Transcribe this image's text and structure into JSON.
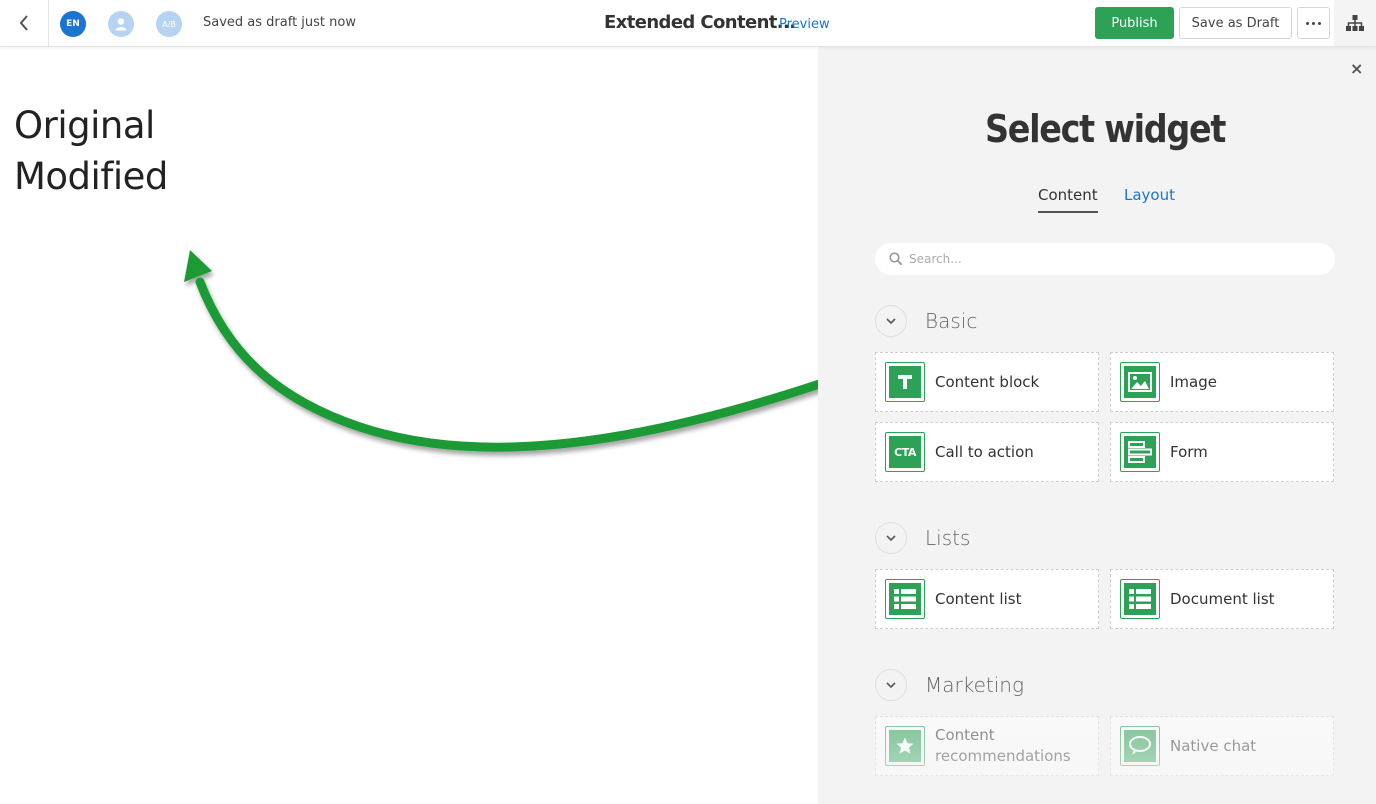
{
  "topbar": {
    "language_badge": "EN",
    "ab_badge": "A/B",
    "draft_status": "Saved as draft just now",
    "page_title": "Extended Content...",
    "preview_label": "Preview",
    "publish_label": "Publish",
    "save_draft_label": "Save as Draft"
  },
  "canvas": {
    "heading_line1": "Original",
    "heading_line2": "Modified"
  },
  "panel": {
    "title": "Select widget",
    "tabs": [
      "Content",
      "Layout"
    ],
    "active_tab": "Content",
    "search_placeholder": "Search...",
    "close_label": "×",
    "groups": [
      {
        "label": "Basic",
        "widgets": [
          {
            "label": "Content block",
            "icon": "text-t-icon"
          },
          {
            "label": "Image",
            "icon": "image-icon"
          },
          {
            "label": "Call to action",
            "icon": "cta-icon",
            "icon_text": "CTA"
          },
          {
            "label": "Form",
            "icon": "form-icon"
          }
        ]
      },
      {
        "label": "Lists",
        "widgets": [
          {
            "label": "Content list",
            "icon": "list-icon"
          },
          {
            "label": "Document list",
            "icon": "list-icon"
          }
        ]
      },
      {
        "label": "Marketing",
        "widgets": [
          {
            "label": "Content recommendations",
            "icon": "star-icon"
          },
          {
            "label": "Native chat",
            "icon": "chat-bubble-icon"
          }
        ]
      }
    ]
  },
  "colors": {
    "accent_green": "#2da257",
    "link_blue": "#1b75d0",
    "panel_bg": "#f3f3f3",
    "arrow_green": "#1f9a34"
  }
}
